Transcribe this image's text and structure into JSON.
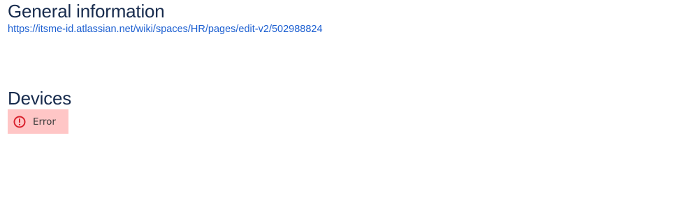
{
  "general": {
    "heading": "General information",
    "link_text": "https://itsme-id.atlassian.net/wiki/spaces/HR/pages/edit-v2/502988824"
  },
  "devices": {
    "heading": "Devices",
    "error": {
      "icon": "error-circle-icon",
      "label": "Error",
      "background_color": "#ffc6c6",
      "icon_color": "#d9232e"
    }
  }
}
